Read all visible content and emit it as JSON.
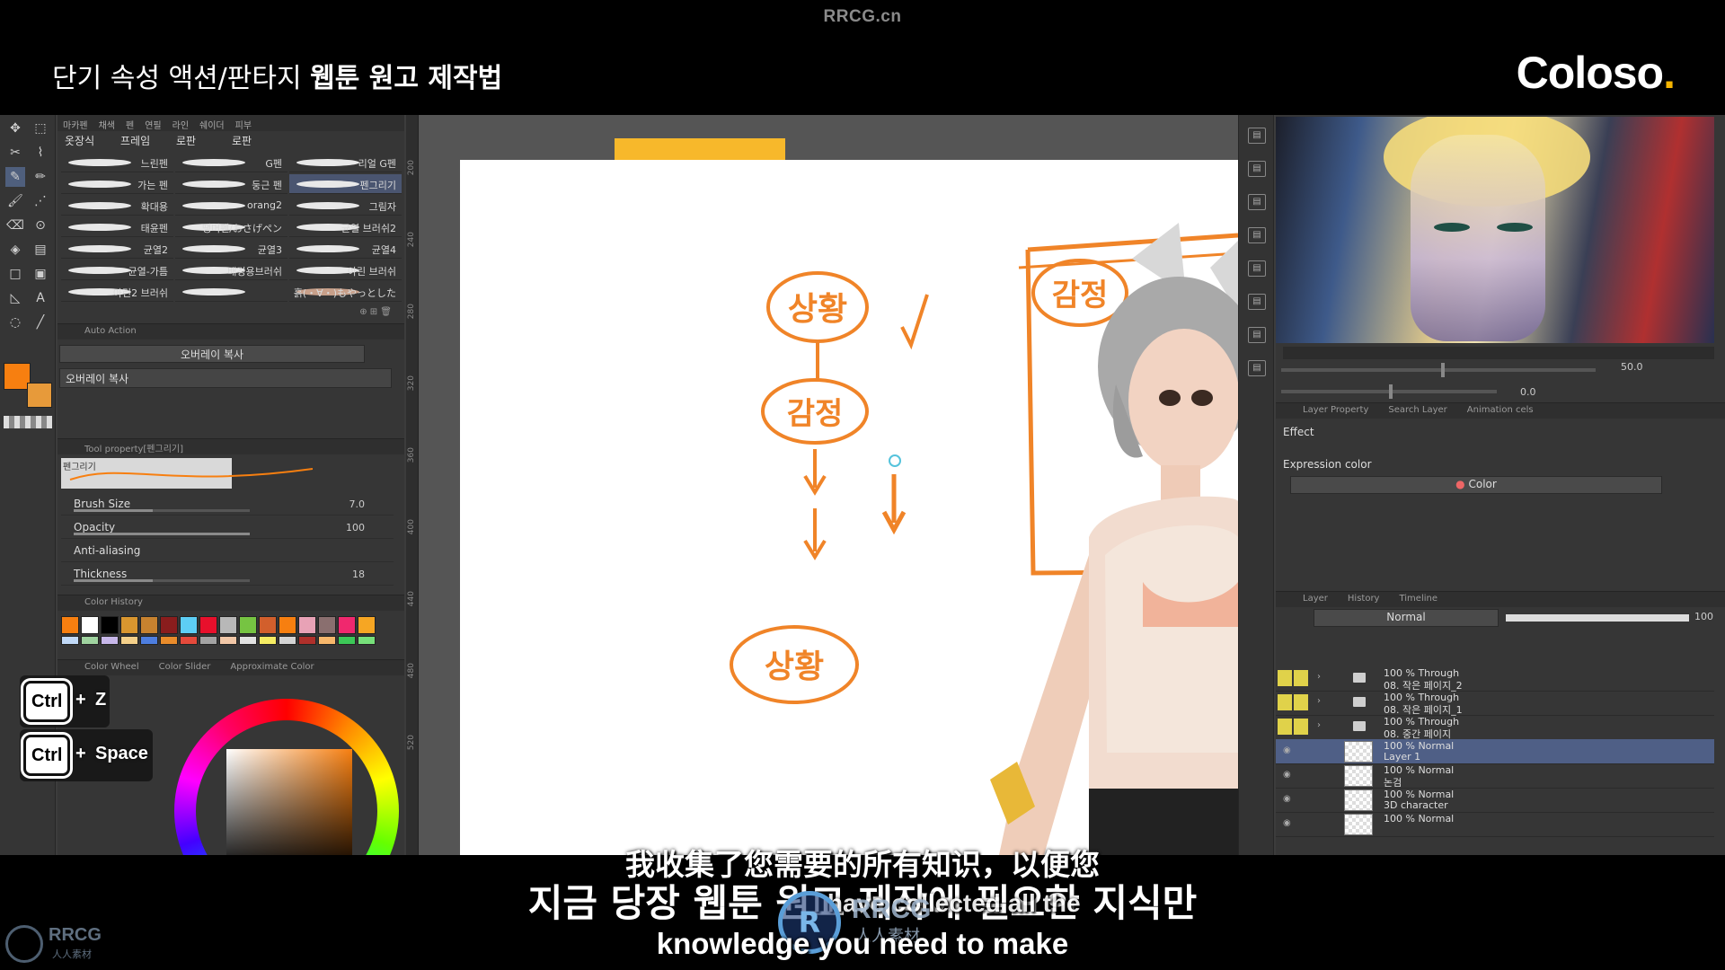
{
  "header": {
    "watermark": "RRCG.cn",
    "course_title_regular": "단기 속성 액션/판타지 ",
    "course_title_bold": "웹툰 원고 제작법",
    "brand": "Coloso",
    "brand_dot": "."
  },
  "toolbar": {
    "tools": [
      "move-icon",
      "select-icon",
      "lasso-icon",
      "eyedropper-icon",
      "pen-icon",
      "pencil-icon",
      "brush-icon",
      "airbrush-icon",
      "eraser-icon",
      "blend-icon",
      "fill-icon",
      "gradient-icon",
      "figure-icon",
      "frame-icon",
      "ruler-icon",
      "text-icon",
      "balloon-icon",
      "line-icon"
    ],
    "main_color": "#f77f10",
    "sub_color": "#e79a3a"
  },
  "subtool": {
    "tabs_top": [
      "마카펜",
      "채색",
      "펜",
      "연필",
      "라인",
      "쉐이더",
      "피부"
    ],
    "tabs": [
      "옷장식",
      "프레임",
      "로판",
      "로판"
    ],
    "brushes": [
      [
        "느린펜",
        "G펜",
        "리얼 G펜"
      ],
      [
        "가는 펜",
        "둥근 펜",
        "펜그리기"
      ],
      [
        "확대용",
        "orang2",
        "그림자"
      ],
      [
        "태윤펜",
        "땡머펜/おさげペン",
        "균열 브러쉬2"
      ],
      [
        "균열2",
        "균열3",
        "균열4"
      ],
      [
        "균열-가틈",
        "배경용브러쉬",
        "아린 브러쉬"
      ],
      [
        "아린2 브러쉬",
        "",
        "흙(・∀・)もやっとした"
      ]
    ],
    "selected_brush": "펜그리기"
  },
  "auto_action": {
    "header": "Auto Action",
    "set": "오버레이 복사",
    "item": "오버레이 복사"
  },
  "tool_property": {
    "header": "Tool property[펜그리기]",
    "preview_label": "펜그리기",
    "rows": [
      {
        "label": "Brush Size",
        "value": "7.0",
        "fill": 0.45
      },
      {
        "label": "Opacity",
        "value": "100",
        "fill": 1.0
      },
      {
        "label": "Anti-aliasing",
        "value": "",
        "fill": 0
      },
      {
        "label": "Thickness",
        "value": "18",
        "fill": 0.45
      }
    ]
  },
  "color_history": {
    "header": "Color History",
    "swatches": [
      "#f77f10",
      "#ffffff",
      "#000000",
      "#d9962f",
      "#c7822f",
      "#8a1d1d",
      "#5dcef5",
      "#e8102c",
      "#b8b8b8",
      "#76c442",
      "#d25f2c",
      "#f77f10",
      "#e8a2b6",
      "#8a6f6f",
      "#f0286e",
      "#f6a623"
    ],
    "swatches_row2": [
      "#c1d9f7",
      "#9fd39f",
      "#c7b7e9",
      "#f4d08a",
      "#4d7ee0",
      "#e98c2b",
      "#e54a3b",
      "#a3a3a3",
      "#f1c7a7",
      "#e2e2e2",
      "#f5ec63",
      "#d4d4d4",
      "#b0302b",
      "#f7b76b",
      "#3cc857",
      "#77e07a"
    ]
  },
  "color_wheel": {
    "tabs": [
      "Color Wheel",
      "Color Slider",
      "Approximate Color"
    ]
  },
  "rulers": {
    "left_ticks": [
      "200",
      "240",
      "280",
      "320",
      "360",
      "400",
      "440",
      "480",
      "520"
    ]
  },
  "canvas": {
    "annotations": {
      "bubble1": "상황",
      "bubble2": "감정",
      "bubble3": "상황",
      "bubble_frame": "감정"
    }
  },
  "navigator": {
    "zoom": "50.0",
    "angle": "0.0"
  },
  "layer_property": {
    "tabs": [
      "Layer Property",
      "Search Layer",
      "Animation cels"
    ],
    "effect_label": "Effect",
    "expression_label": "Expression color",
    "expression_value": "Color"
  },
  "layers": {
    "tabs": [
      "Layer",
      "History",
      "Timeline"
    ],
    "blend_mode": "Normal",
    "opacity": "100",
    "rows": [
      {
        "line1": "100 % Through",
        "line2": "08. 작은 페이지_2",
        "type": "folder",
        "selected": false
      },
      {
        "line1": "100 % Through",
        "line2": "08. 작은 페이지_1",
        "type": "folder",
        "selected": false
      },
      {
        "line1": "100 % Through",
        "line2": "08. 중간 페이지",
        "type": "folder",
        "selected": false
      },
      {
        "line1": "100 % Normal",
        "line2": "Layer 1",
        "type": "raster",
        "selected": true
      },
      {
        "line1": "100 % Normal",
        "line2": "논검",
        "type": "raster",
        "selected": false
      },
      {
        "line1": "100 % Normal",
        "line2": "3D character",
        "type": "3d",
        "selected": false
      },
      {
        "line1": "100 % Normal",
        "line2": "",
        "type": "raster",
        "selected": false
      }
    ]
  },
  "shortcuts": [
    {
      "key": "Ctrl",
      "rest": "Z"
    },
    {
      "key": "Ctrl",
      "rest": "Space"
    }
  ],
  "shortcut_plus": "+",
  "subtitles": {
    "zh": "我收集了您需要的所有知识，以便您",
    "ko": "지금 당장 웹툰 원고 제작에 필요한 지식만",
    "en_mid": "I have collected all the",
    "en": "knowledge you need to make"
  },
  "watermark": {
    "center": "RRCG",
    "center_sub": "人人素材",
    "corner": "RRCG",
    "corner_sub": "人人素材",
    "logo_letter": "R"
  }
}
